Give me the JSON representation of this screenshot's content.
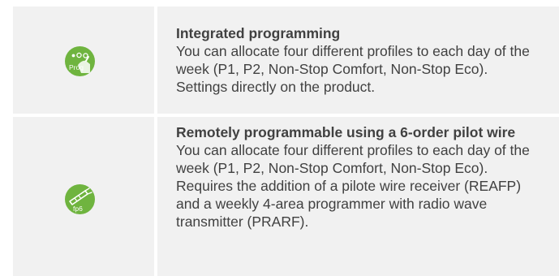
{
  "features": [
    {
      "icon": "prog-icon",
      "icon_label": "Prog",
      "icon_color": "#6fb43f",
      "title": "Integrated programming",
      "description": [
        "You can allocate four different profiles to each day of the week (P1, P2, Non-Stop Comfort, Non-Stop Eco). Settings directly on the product."
      ]
    },
    {
      "icon": "pilot-wire-fp6-icon",
      "icon_label": "fp6",
      "icon_color": "#6fb43f",
      "title": "Remotely programmable using a 6-order pilot wire",
      "description": [
        "You can allocate four different profiles to each day of the week (P1, P2, Non-Stop Comfort, Non-Stop Eco).",
        "Requires the addition of a pilote wire receiver (REAFP) and a weekly 4-area programmer with radio wave transmitter (PRARF)."
      ]
    }
  ]
}
